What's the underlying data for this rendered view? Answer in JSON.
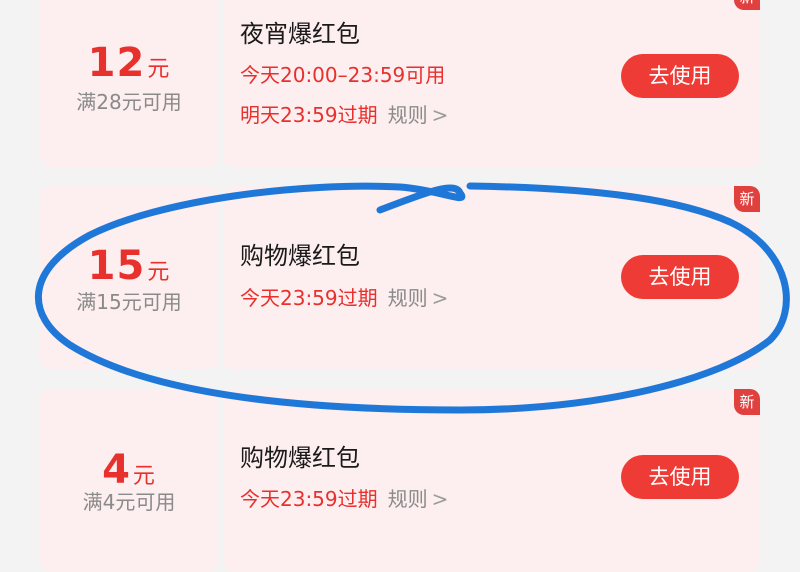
{
  "coupons": [
    {
      "amount": "12",
      "unit": "元",
      "threshold": "满28元可用",
      "title": "夜宵爆红包",
      "time_window": "今天20:00–23:59可用",
      "expiry": "明天23:59过期",
      "rule_label": "规则",
      "button_label": "去使用",
      "badge": "新"
    },
    {
      "amount": "15",
      "unit": "元",
      "threshold": "满15元可用",
      "title": "购物爆红包",
      "expiry": "今天23:59过期",
      "rule_label": "规则",
      "button_label": "去使用",
      "badge": "新"
    },
    {
      "amount": "4",
      "unit": "元",
      "threshold": "满4元可用",
      "title": "购物爆红包",
      "expiry": "今天23:59过期",
      "rule_label": "规则",
      "button_label": "去使用",
      "badge": "新"
    }
  ],
  "colors": {
    "accent": "#e8302d",
    "button": "#ee3b35",
    "card_bg": "#fdeeef",
    "page_bg": "#f3f3f3",
    "annotation_stroke": "#1f78d8"
  },
  "icons": {
    "rule_chevron": "chevron-right-icon"
  }
}
